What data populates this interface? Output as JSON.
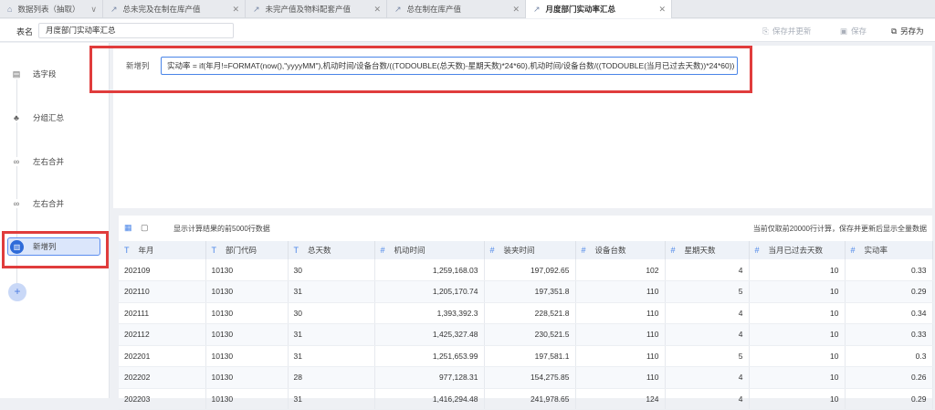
{
  "tabs": [
    {
      "icon": "home-icon",
      "label": "数据列表（抽取）",
      "has_dropdown": true
    },
    {
      "icon": "analysis-icon",
      "label": "总未完及在制在库产值",
      "closable": true
    },
    {
      "icon": "analysis-icon",
      "label": "未完产值及物料配套产值",
      "closable": true
    },
    {
      "icon": "analysis-icon",
      "label": "总在制在库产值",
      "closable": true
    },
    {
      "icon": "analysis-icon",
      "label": "月度部门实动率汇总",
      "closable": true,
      "active": true
    }
  ],
  "toolbar": {
    "table_label": "表名",
    "table_name": "月度部门实动率汇总",
    "save_update_label": "保存并更新",
    "save_label": "保存",
    "save_as_label": "另存为"
  },
  "sidebar": {
    "items": [
      {
        "label": "选字段",
        "icon": "field-select-icon"
      },
      {
        "label": "分组汇总",
        "icon": "group-summary-icon"
      },
      {
        "label": "左右合并",
        "icon": "merge-icon"
      },
      {
        "label": "左右合并",
        "icon": "merge-icon"
      },
      {
        "label": "新增列",
        "icon": "new-column-icon",
        "active": true
      }
    ],
    "add_label": "+"
  },
  "formula": {
    "label": "新增列",
    "value": "实动率 = if(年月!=FORMAT(now(),\"yyyyMM\"),机动时间/设备台数/((TODOUBLE(总天数)-星期天数)*24*60),机动时间/设备台数/((TODOUBLE(当月已过去天数))*24*60))"
  },
  "data_panel": {
    "info_text": "显示计算结果的前5000行数据",
    "right_text": "当前仅取前20000行计算，保存并更新后显示全量数据",
    "columns": [
      {
        "type": "T",
        "name": "年月"
      },
      {
        "type": "T",
        "name": "部门代码"
      },
      {
        "type": "T",
        "name": "总天数"
      },
      {
        "type": "#",
        "name": "机动时间"
      },
      {
        "type": "#",
        "name": "装夹时间"
      },
      {
        "type": "#",
        "name": "设备台数"
      },
      {
        "type": "#",
        "name": "星期天数"
      },
      {
        "type": "#",
        "name": "当月已过去天数"
      },
      {
        "type": "#",
        "name": "实动率"
      }
    ],
    "rows": [
      [
        "202109",
        "10130",
        "30",
        "1,259,168.03",
        "197,092.65",
        "102",
        "4",
        "10",
        "0.33"
      ],
      [
        "202110",
        "10130",
        "31",
        "1,205,170.74",
        "197,351.8",
        "110",
        "5",
        "10",
        "0.29"
      ],
      [
        "202111",
        "10130",
        "30",
        "1,393,392.3",
        "228,521.8",
        "110",
        "4",
        "10",
        "0.34"
      ],
      [
        "202112",
        "10130",
        "31",
        "1,425,327.48",
        "230,521.5",
        "110",
        "4",
        "10",
        "0.33"
      ],
      [
        "202201",
        "10130",
        "31",
        "1,251,653.99",
        "197,581.1",
        "110",
        "5",
        "10",
        "0.3"
      ],
      [
        "202202",
        "10130",
        "28",
        "977,128.31",
        "154,275.85",
        "110",
        "4",
        "10",
        "0.26"
      ],
      [
        "202203",
        "10130",
        "31",
        "1,416,294.48",
        "241,978.65",
        "124",
        "4",
        "10",
        "0.29"
      ]
    ]
  }
}
